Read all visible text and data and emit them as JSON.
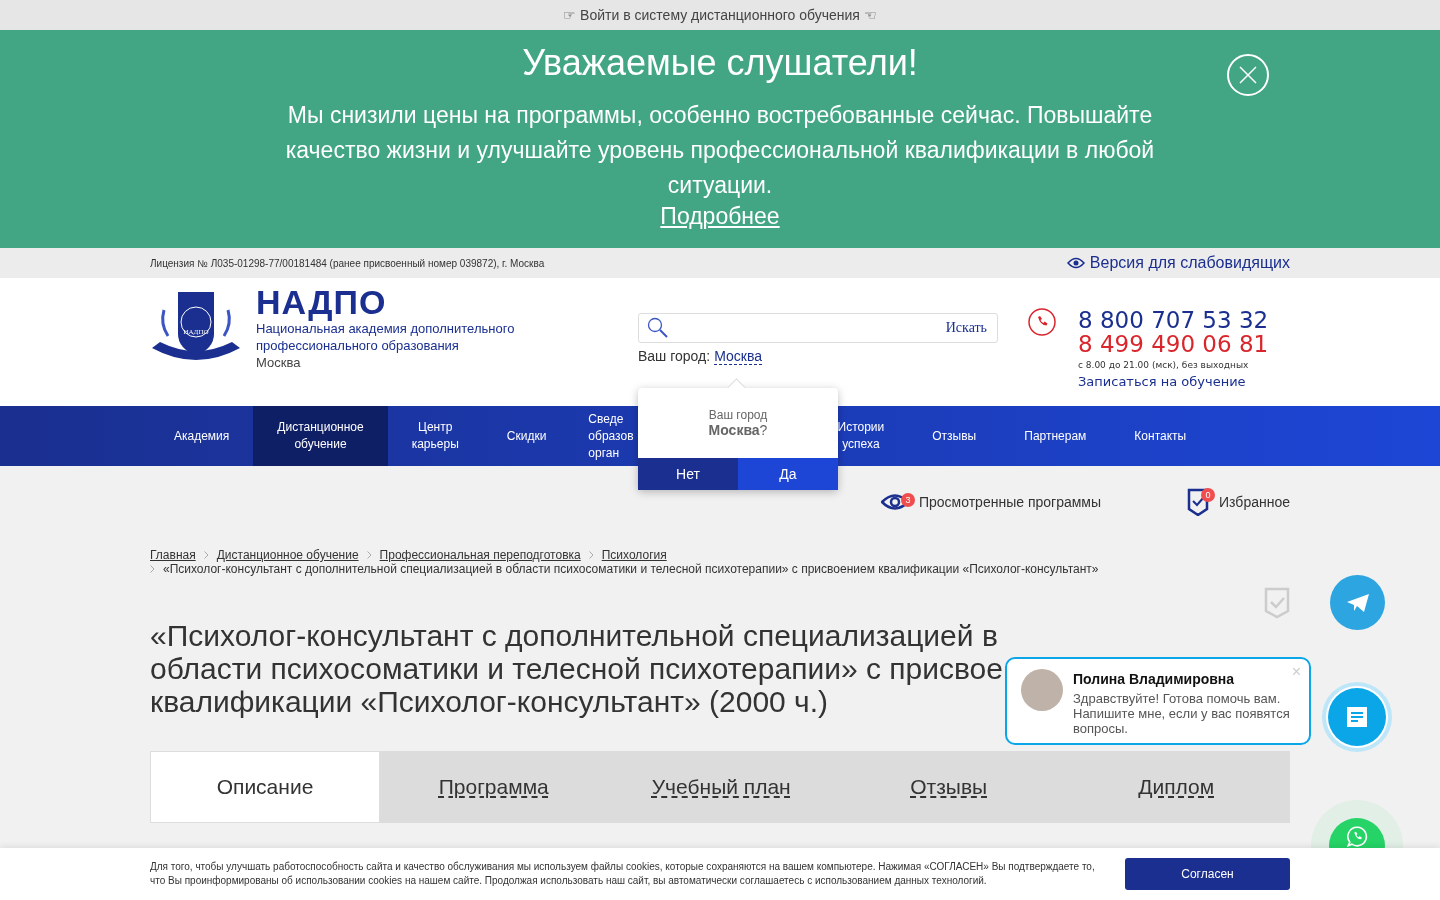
{
  "top_bar": {
    "link": "☞ Войти в систему дистанционного обучения ☜"
  },
  "banner": {
    "title": "Уважаемые слушатели!",
    "text": "Мы снизили цены на программы, особенно востребованные сейчас. Повышайте качество жизни и улучшайте уровень профессиональной квалификации в любой ситуации.",
    "link": "Подробнее"
  },
  "license_bar": {
    "license": "Лицензия № Л035-01298-77/00181484 (ранее присвоенный номер 039872), г. Москва",
    "accessibility_link": "Версия для слабовидящих"
  },
  "header": {
    "logo_name": "НАДПО",
    "logo_emblem_text": "НАДПО",
    "subtitle": "Национальная академия дополнительного профессионального образования",
    "city": "Москва",
    "search": {
      "button": "Искать"
    },
    "city_label": "Ваш город:",
    "city_link": "Москва",
    "phones": [
      {
        "number": "8 800 707 53 32",
        "color": "#1a2f8f"
      },
      {
        "number": "8 499 490 06 81",
        "color": "#d9262c"
      }
    ],
    "hours": "с 8.00 до 21.00 (мск), без выходных",
    "enroll_link": "Записаться на обучение"
  },
  "nav": [
    {
      "kind": "link",
      "lines": [
        "Академия"
      ],
      "selected": false
    },
    {
      "kind": "link",
      "lines": [
        "Дистанционное",
        "обучение"
      ],
      "selected": true
    },
    {
      "kind": "link",
      "lines": [
        "Центр",
        "карьеры"
      ],
      "selected": false
    },
    {
      "kind": "link",
      "lines": [
        "Скидки"
      ],
      "selected": false
    },
    {
      "kind": "covered",
      "lines": [
        "Сведе",
        "образов",
        "орган"
      ],
      "selected": false
    },
    {
      "kind": "link",
      "lines": [
        "Истории",
        "успеха"
      ],
      "selected": false
    },
    {
      "kind": "link",
      "lines": [
        "Отзывы"
      ],
      "selected": false
    },
    {
      "kind": "link",
      "lines": [
        "Партнерам"
      ],
      "selected": false
    },
    {
      "kind": "link",
      "lines": [
        "Контакты"
      ],
      "selected": false
    }
  ],
  "city_popup": {
    "label": "Ваш город",
    "city": "Москва",
    "question": "?",
    "buttons": [
      {
        "label": "Нет",
        "selected": false
      },
      {
        "label": "Да",
        "selected": true
      }
    ]
  },
  "user_links": [
    {
      "kind": "viewed",
      "count": "3",
      "label": "Просмотренные программы"
    },
    {
      "kind": "favorites",
      "count": "0",
      "label": "Избранное"
    }
  ],
  "breadcrumbs": [
    "Главная",
    "Дистанционное обучение",
    "Профессиональная переподготовка",
    "Психология"
  ],
  "breadcrumb_current": "«Психолог-консультант с дополнительной специализацией в области психосоматики и телесной психотерапии» с присвоением квалификации «Психолог-консультант»",
  "page_title_lines": [
    "«Психолог-консультант с дополнительной специализацией в",
    "области психосоматики и телесной психотерапии» с присвое",
    "квалификации «Психолог-консультант» (2000 ч.)"
  ],
  "tabs": [
    {
      "label": "Описание",
      "selected": true
    },
    {
      "label": "Программа",
      "selected": false
    },
    {
      "label": "Учебный план",
      "selected": false
    },
    {
      "label": "Отзывы",
      "selected": false
    },
    {
      "label": "Диплом",
      "selected": false
    }
  ],
  "chat": {
    "name": "Полина Владимировна",
    "message": "Здравствуйте! Готова помочь вам. Напишите мне, если у вас появятся вопросы.",
    "close": "×"
  },
  "cookie": {
    "text": "Для того, чтобы улучшать работоспособность сайта и качество обслуживания мы используем файлы cookies, которые сохраняются на вашем компьютере. Нажимая «СОГЛАСЕН» Вы подтверждаете то, что Вы проинформированы об использовании cookies на нашем сайте. Продолжая использовать наш сайт, вы автоматически соглашаетесь с использованием данных технологий.",
    "button": "Согласен"
  }
}
